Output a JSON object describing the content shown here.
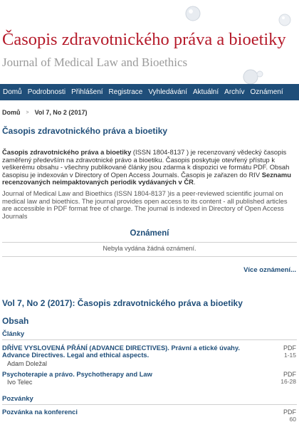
{
  "header": {
    "title": "Časopis zdravotnického práva a bioetiky",
    "subtitle": "Journal of Medical Law and Bioethics"
  },
  "nav": {
    "items": [
      "Domů",
      "Podrobnosti",
      "Přihlášení",
      "Registrace",
      "Vyhledávání",
      "Aktuální",
      "Archív",
      "Oznámení"
    ]
  },
  "breadcrumb": {
    "home": "Domů",
    "separator": ">",
    "current": "Vol 7, No 2 (2017)"
  },
  "main": {
    "title": "Časopis zdravotnického práva a bioetiky",
    "intro_cz": {
      "journal_name": "Časopis zdravotnického práva a bioetiky",
      "text1": " (ISSN 1804-8137 ) je recenzovaný vědecký časopis zaměřený především na zdravotnické právo a bioetiku. Časopis poskytuje otevřený přístup k veškerému obsahu - všechny publikované články jsou zdarma k dispozici ve formátu PDF. Obsah časopisu je indexován v Directory of Open Access Journals. Časopis je zařazen do RIV ",
      "list_name": "Seznamu recenzovaných neimpaktovaných periodik vydávaných v ČR",
      "text2": "."
    },
    "intro_en": "Journal of Medical Law and Bioethics (ISSN 1804-8137 )is a peer-reviewed scientific journal on medical law and bioethics. The journal provides open access to its content - all published articles are accessible in PDF format free of charge. The journal is indexed in Directory of Open Access Journals"
  },
  "announcements": {
    "title": "Oznámení",
    "empty": "Nebyla vydána žádná oznámení.",
    "more": "Více oznámení..."
  },
  "issue": {
    "title": "Vol 7, No 2 (2017): Časopis zdravotnického práva a bioetiky",
    "toc_title": "Obsah",
    "sections": [
      {
        "name": "Články",
        "articles": [
          {
            "title_line1": "DŘÍVE VYSLOVENÁ PŘÁNÍ (ADVANCE DIRECTIVES). Právní a etické úvahy.",
            "title_line2": "Advance Directives. Legal and ethical aspects.",
            "author": "Adam Doležal",
            "link": "PDF",
            "pages": "1-15"
          },
          {
            "title_line1": "Psychoterapie a právo. Psychotherapy and Law",
            "title_line2": "",
            "author": "Ivo Telec",
            "link": "PDF",
            "pages": "16-28"
          }
        ]
      },
      {
        "name": "Pozvánky",
        "articles": [
          {
            "title_line1": "Pozvánka na konferenci",
            "title_line2": "",
            "author": "",
            "link": "PDF",
            "pages": "60"
          }
        ]
      }
    ]
  }
}
